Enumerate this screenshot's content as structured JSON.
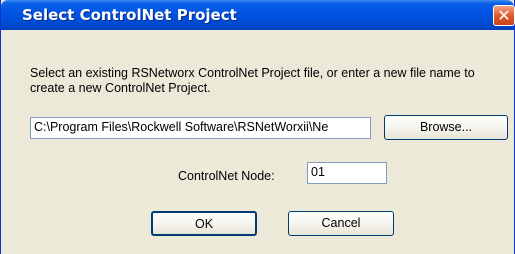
{
  "dialog": {
    "title": "Select ControlNet Project",
    "close_glyph": "✕",
    "description": "Select an existing RSNetworx ControlNet Project file, or enter a new file name to create a new ControlNet Project.",
    "path_value": "C:\\Program Files\\Rockwell Software\\RSNetWorxii\\Ne",
    "browse_label": "Browse...",
    "node_label": "ControlNet Node:",
    "node_value": "01",
    "ok_label": "OK",
    "cancel_label": "Cancel"
  },
  "colors": {
    "titlebar": "#0054e3",
    "dialog_bg": "#ece9d8",
    "close_button": "#e25a2c"
  }
}
